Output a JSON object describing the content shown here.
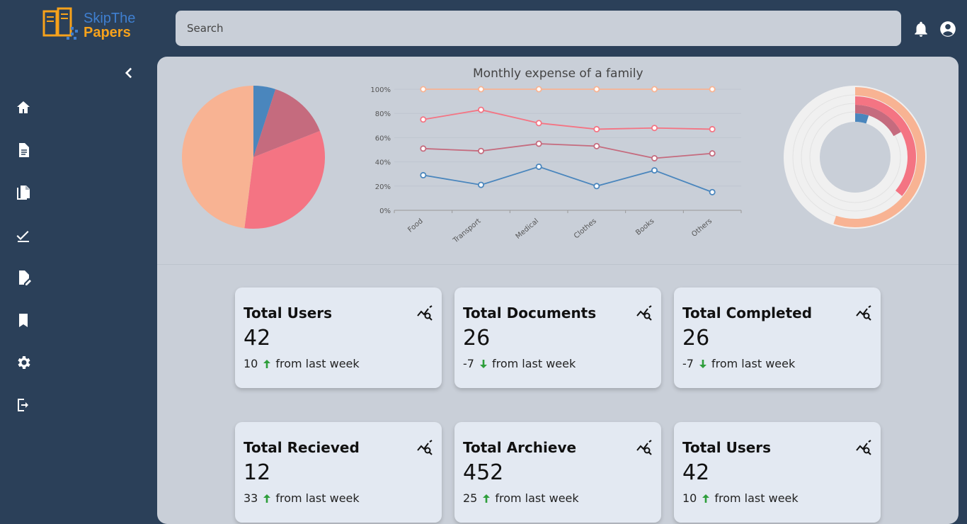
{
  "header": {
    "logo": {
      "line1": "SkipThe",
      "line2": "Papers"
    },
    "search": {
      "placeholder": "Search"
    }
  },
  "sidebar": {
    "items": [
      {
        "name": "home",
        "icon": "home-icon"
      },
      {
        "name": "documents",
        "icon": "document-icon"
      },
      {
        "name": "copies",
        "icon": "file-copy-icon"
      },
      {
        "name": "completed",
        "icon": "checkmark-icon"
      },
      {
        "name": "edit",
        "icon": "edit-document-icon"
      },
      {
        "name": "bookmarks",
        "icon": "bookmark-icon"
      },
      {
        "name": "settings",
        "icon": "gear-icon"
      },
      {
        "name": "logout",
        "icon": "logout-icon"
      }
    ]
  },
  "colors": {
    "blue": "#4a86bd",
    "mauve": "#c56b7e",
    "coral": "#f47483",
    "peach": "#f8b393",
    "sidebar": "#2b4059",
    "up_arrow": "#2e9e3b",
    "down_arrow": "#2e9e3b"
  },
  "chart_data": [
    {
      "type": "pie",
      "slices": [
        {
          "value": 5,
          "color": "#4a86bd"
        },
        {
          "value": 14,
          "color": "#c56b7e"
        },
        {
          "value": 33,
          "color": "#f47483"
        },
        {
          "value": 48,
          "color": "#f8b393"
        }
      ]
    },
    {
      "type": "line",
      "title": "Monthly expense of a family",
      "categories": [
        "Food",
        "Transport",
        "Medical",
        "Clothes",
        "Books",
        "Others"
      ],
      "ylim": [
        0,
        100
      ],
      "yticks": [
        "0%",
        "20%",
        "40%",
        "60%",
        "80%",
        "100%"
      ],
      "grid": true,
      "series": [
        {
          "color": "#4a86bd",
          "values": [
            29,
            21,
            36,
            20,
            33,
            15
          ]
        },
        {
          "color": "#c56b7e",
          "values": [
            51,
            49,
            55,
            53,
            43,
            47
          ]
        },
        {
          "color": "#f47483",
          "values": [
            75,
            83,
            72,
            67,
            68,
            67
          ]
        },
        {
          "color": "#f8b393",
          "values": [
            100,
            100,
            100,
            100,
            100,
            100
          ]
        }
      ]
    },
    {
      "type": "radial-bar",
      "rings": [
        {
          "value": 5,
          "color": "#4a86bd"
        },
        {
          "value": 17,
          "color": "#c56b7e"
        },
        {
          "value": 36,
          "color": "#f47483"
        },
        {
          "value": 55,
          "color": "#f8b393"
        }
      ]
    }
  ],
  "stats": [
    {
      "title": "Total Users",
      "value": "42",
      "delta": "10",
      "direction": "up",
      "suffix": "from last week"
    },
    {
      "title": "Total Documents",
      "value": "26",
      "delta": "-7",
      "direction": "down",
      "suffix": "from last week"
    },
    {
      "title": "Total Completed",
      "value": "26",
      "delta": "-7",
      "direction": "down",
      "suffix": "from last week"
    },
    {
      "title": "Total Recieved",
      "value": "12",
      "delta": "33",
      "direction": "up",
      "suffix": "from last week"
    },
    {
      "title": "Total Archieve",
      "value": "452",
      "delta": "25",
      "direction": "up",
      "suffix": "from last week"
    },
    {
      "title": "Total Users",
      "value": "42",
      "delta": "10",
      "direction": "up",
      "suffix": "from last week"
    }
  ]
}
